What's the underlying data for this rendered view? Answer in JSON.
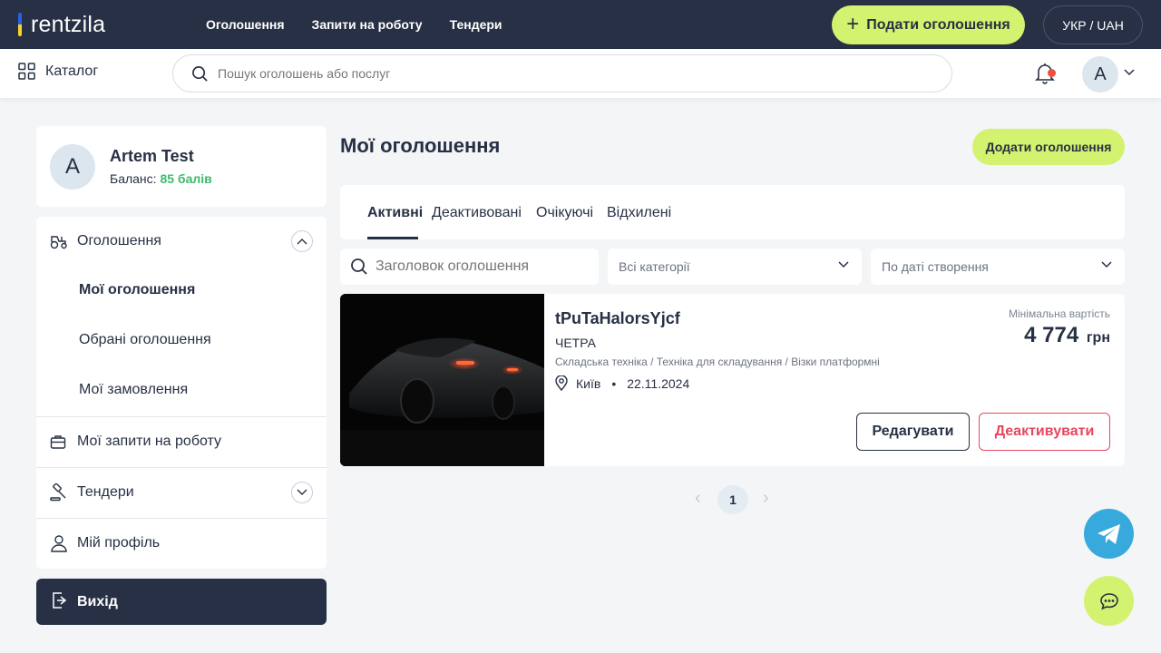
{
  "header": {
    "logo": "rentzila",
    "nav": [
      "Оголошення",
      "Запити на роботу",
      "Тендери"
    ],
    "post_button": "Подати оголошення",
    "language": "УКР / UAH"
  },
  "subbar": {
    "catalog_label": "Каталог",
    "search_placeholder": "Пошук оголошень або послуг",
    "avatar_letter": "A"
  },
  "profile": {
    "avatar_letter": "A",
    "name": "Artem Test",
    "balance_label": "Баланс:",
    "balance_value": "85 балів"
  },
  "sidebar": {
    "ads_section": "Оголошення",
    "ads_sub": [
      "Мої оголошення",
      "Обрані оголошення",
      "Мої замовлення"
    ],
    "work_requests": "Мої запити на роботу",
    "tenders": "Тендери",
    "profile": "Мій профіль",
    "logout": "Вихід"
  },
  "main": {
    "title": "Мої оголошення",
    "add_button": "Додати оголошення",
    "tabs": [
      "Активні",
      "Деактивовані",
      "Очікуючі",
      "Відхилені"
    ],
    "search_placeholder": "Заголовок оголошення",
    "category_select": "Всі категорії",
    "sort_select": "По даті створення"
  },
  "listing": {
    "title": "tPuTaHalorsYjcf",
    "brand": "ЧЕТРА",
    "category_path": "Складська техніка / Техніка для складування / Візки платформні",
    "city": "Київ",
    "date": "22.11.2024",
    "price_label": "Мінімальна вартість",
    "price": "4 774",
    "currency": "грн",
    "edit_button": "Редагувати",
    "deactivate_button": "Деактивувати"
  },
  "pagination": {
    "prev": "‹",
    "current_page": "1",
    "next": "›"
  },
  "colors": {
    "navy": "#273044",
    "accent": "#d3f26f",
    "balance_green": "#3fb96e",
    "danger": "#e8465e",
    "telegram": "#38a9dc"
  },
  "icons": [
    "grid-icon",
    "search-icon",
    "bell-icon",
    "chevron-down-icon",
    "tractor-icon",
    "briefcase-icon",
    "gavel-icon",
    "user-icon",
    "logout-icon",
    "location-pin-icon",
    "telegram-icon",
    "chat-icon"
  ]
}
